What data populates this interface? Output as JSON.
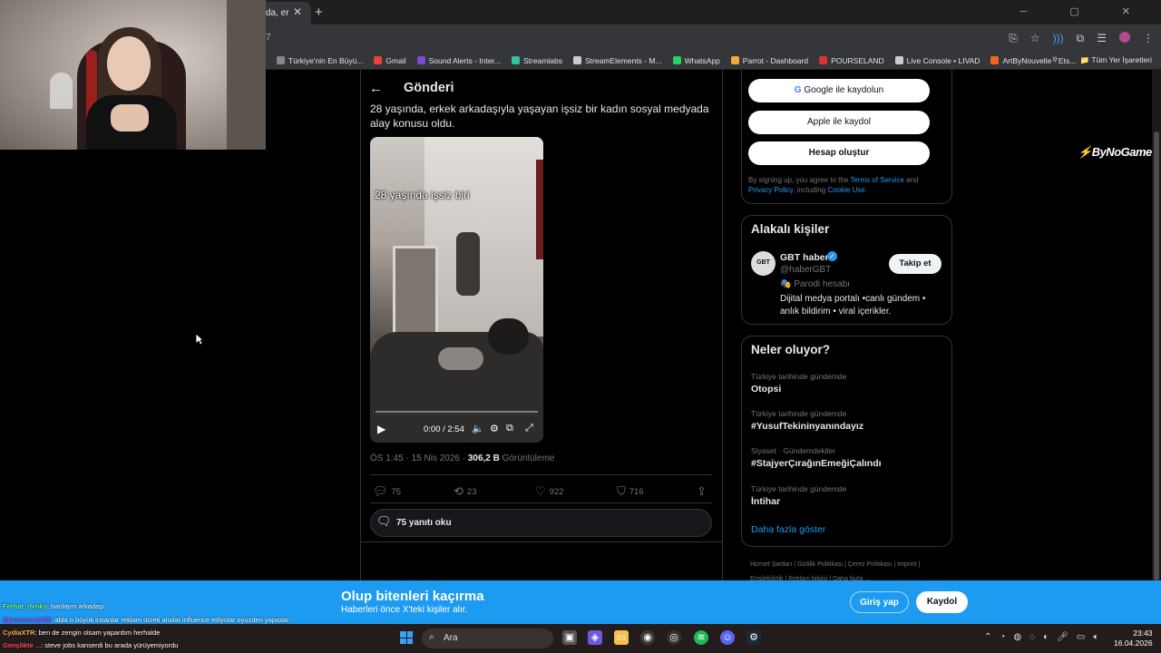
{
  "browser": {
    "tab_title": "da, er",
    "tab_close": "✕",
    "new_tab": "+",
    "window_controls": "─ ▢ ✕",
    "url_fragment": "7",
    "bookmarks": [
      {
        "label": "Türkiye'nin En Büyü...",
        "color": "#888888"
      },
      {
        "label": "Gmail",
        "color": "#ea4335"
      },
      {
        "label": "Sound Alerts - Inter...",
        "color": "#7b4bd1"
      },
      {
        "label": "Streamlabs",
        "color": "#31c3a2"
      },
      {
        "label": "StreamElements - M...",
        "color": "#cccccc"
      },
      {
        "label": "WhatsApp",
        "color": "#25d366"
      },
      {
        "label": "Parrot - Dashboard",
        "color": "#f2a93b"
      },
      {
        "label": "POURSELAND",
        "color": "#e0312f"
      },
      {
        "label": "Live Console • LIVAD",
        "color": "#cccccc"
      },
      {
        "label": "ArtByNouvelle - Ets...",
        "color": "#f1641e"
      }
    ],
    "more_bookmarks": "»",
    "all_bookmarks": "Tüm Yer İşaretleri"
  },
  "post": {
    "header_title": "Gönderi",
    "text": "28 yaşında, erkek arkadaşıyla yaşayan işsiz bir kadın sosyal medyada alay konusu oldu.",
    "video_caption": "28 yaşında işsiz biri",
    "video_time": "0:00 / 2:54",
    "video_progress": 0.0,
    "meta_time": "ÖS 1:45 · 15 Nis 2026 · ",
    "meta_views_value": "306,2 B",
    "meta_views_label": " Görüntüleme",
    "replies": "75",
    "reposts": "23",
    "likes": "922",
    "bookmarks": "716",
    "read_replies": "75 yanıtı oku"
  },
  "signup": {
    "google": "Google ile kaydolun",
    "apple": "Apple ile kaydol",
    "create": "Hesap oluştur",
    "terms_prefix": "By signing up, you agree to the ",
    "terms_link": "Terms of Service",
    "terms_and": " and ",
    "privacy_link": "Privacy Policy",
    "including": ", including ",
    "cookie_link": "Cookie Use",
    "period": "."
  },
  "related": {
    "title": "Alakalı kişiler",
    "avatar_text": "GBT",
    "name": "GBT haber",
    "handle": "@haberGBT",
    "parody": "🎭 Parodi hesabı",
    "bio": "Dijital medya portalı •canlı gündem • anlık bildirim • viral içerikler.",
    "follow": "Takip et"
  },
  "trends": {
    "title": "Neler oluyor?",
    "items": [
      {
        "context": "Türkiye tarihinde gündemde",
        "name": "Otopsi"
      },
      {
        "context": "Türkiye tarihinde gündemde",
        "name": "#YusufTekininyanındayız"
      },
      {
        "context": "Siyaset · Gündemdekiler",
        "name": "#StajyerÇırağınEmeğiÇalındı"
      },
      {
        "context": "Türkiye tarihinde gündemde",
        "name": "İntihar"
      }
    ],
    "show_more": "Daha fazla göster"
  },
  "footer": {
    "links": "Hizmet Şartları  |  Gizlilik Politikası  |  Çerez Politikası  |  Imprint  |  Erişilebilirlik  |  Reklam bilgisi  |  Daha fazla ..."
  },
  "overlay": {
    "brand_mark": "⚡",
    "brand_name": "ByNoGame"
  },
  "banner": {
    "title": "Olup bitenleri kaçırma",
    "subtitle": "Haberleri önce X'teki kişiler alır.",
    "login": "Giriş yap",
    "register": "Kaydol"
  },
  "chat": [
    {
      "user": "Ferhat_dvnky",
      "user_color": "#7cf27c",
      "msg": ": banlayın arkadaşı"
    },
    {
      "user": "Bjarnsson1985",
      "user_color": "#9b59ff",
      "msg": ": abla o büyük insanlar reklam ücreti alıolar influence ediyolar oyuzden yapıolar"
    },
    {
      "user": "CydiaXTR",
      "user_color": "#ffb347",
      "msg": ": ben de zengin olsam yapardım herhalde"
    },
    {
      "user": "Gençlikte ...",
      "user_color": "#ff4d4d",
      "msg": ": steve jobs kanserdi bu arada yürüyemiyordu"
    }
  ],
  "taskbar": {
    "search": "Ara",
    "time": "23:43",
    "date": "16.04.2026"
  }
}
